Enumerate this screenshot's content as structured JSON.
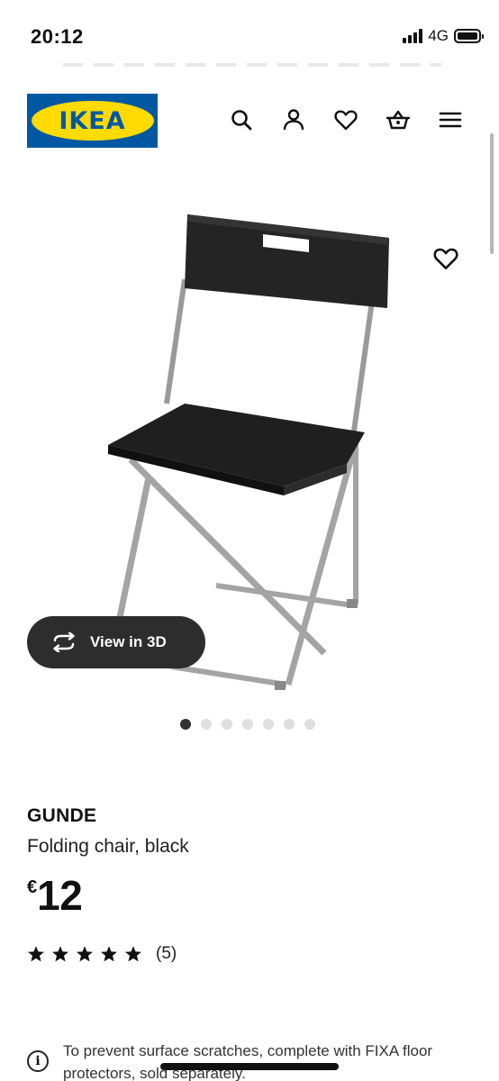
{
  "status_bar": {
    "time": "20:12",
    "network": "4G"
  },
  "header": {
    "logo_text": "IKEA",
    "icons": [
      "search-icon",
      "account-icon",
      "heart-icon",
      "basket-icon",
      "menu-icon"
    ],
    "brand_blue": "#0058a3",
    "brand_yellow": "#ffdb00"
  },
  "gallery": {
    "view_3d_label": "View in 3D",
    "image_count": 7,
    "active_index": 0
  },
  "product": {
    "name": "GUNDE",
    "description": "Folding chair, black",
    "currency": "€",
    "price": "12",
    "rating_stars": 5,
    "review_count": "(5)"
  },
  "notice": {
    "text": "To prevent surface scratches, complete with FIXA floor protectors, sold separately."
  }
}
